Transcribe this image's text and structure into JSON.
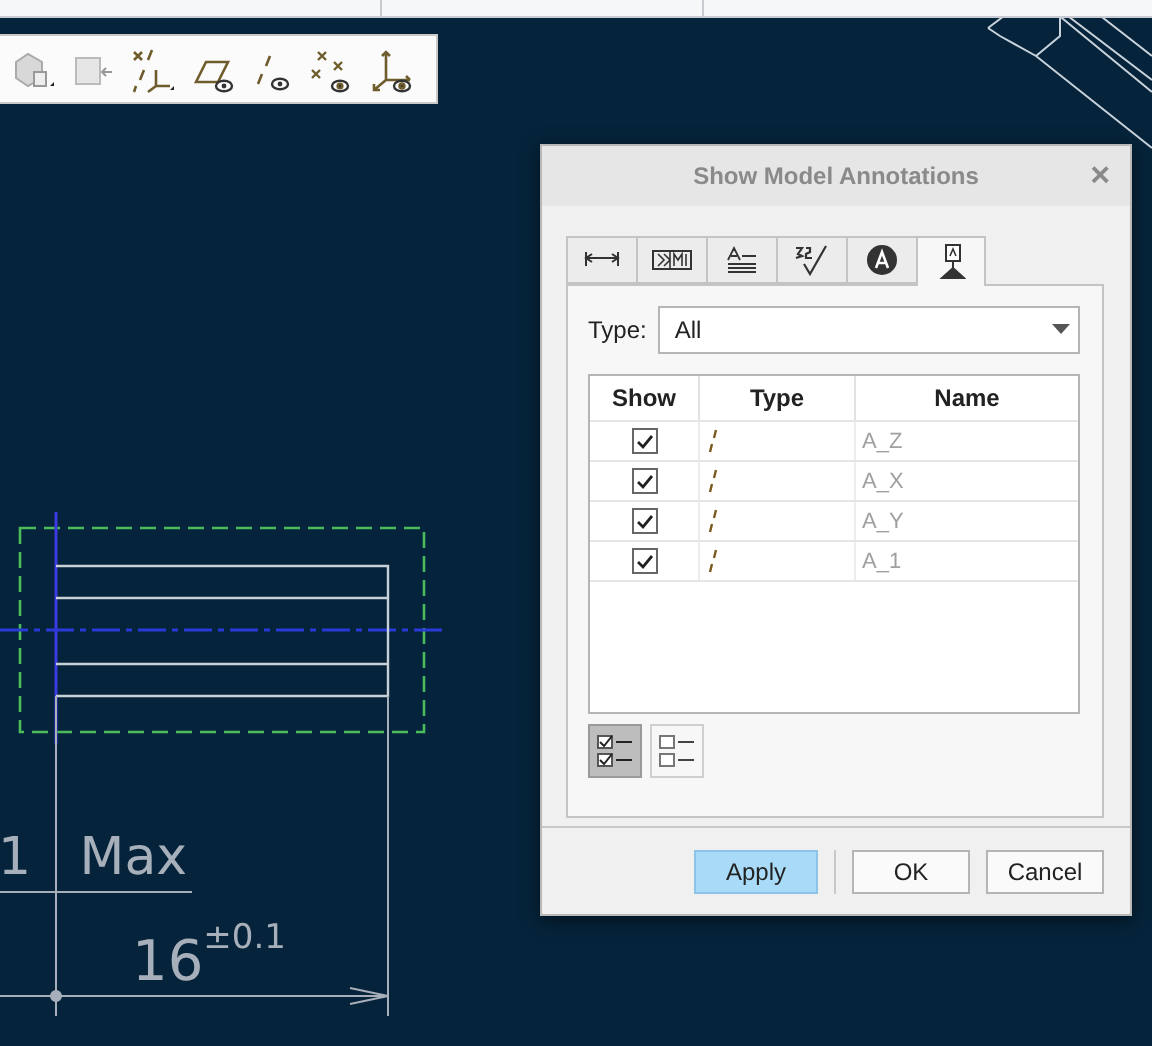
{
  "drawing": {
    "note": "1 Max",
    "dimension": "16",
    "tolerance": "±0.1"
  },
  "dialog": {
    "title": "Show Model Annotations",
    "close": "×",
    "tabs": [
      {
        "kind": "dimension",
        "selected": false
      },
      {
        "kind": "gtol",
        "selected": false
      },
      {
        "kind": "note",
        "selected": false
      },
      {
        "kind": "finish",
        "selected": false
      },
      {
        "kind": "symbol",
        "selected": false
      },
      {
        "kind": "datum",
        "selected": true
      }
    ],
    "type_label": "Type:",
    "type_value": "All",
    "columns": [
      "Show",
      "Type",
      "Name"
    ],
    "rows": [
      {
        "checked": true,
        "name": "A_Z"
      },
      {
        "checked": true,
        "name": "A_X"
      },
      {
        "checked": true,
        "name": "A_Y"
      },
      {
        "checked": true,
        "name": "A_1"
      }
    ],
    "list_buttons": [
      {
        "kind": "check_all",
        "selected": true
      },
      {
        "kind": "uncheck_all",
        "selected": false
      }
    ],
    "footer_buttons": [
      {
        "label": "Apply",
        "kind": "primary"
      },
      {
        "label": "OK",
        "kind": "normal"
      },
      {
        "label": "Cancel",
        "kind": "normal"
      }
    ]
  }
}
